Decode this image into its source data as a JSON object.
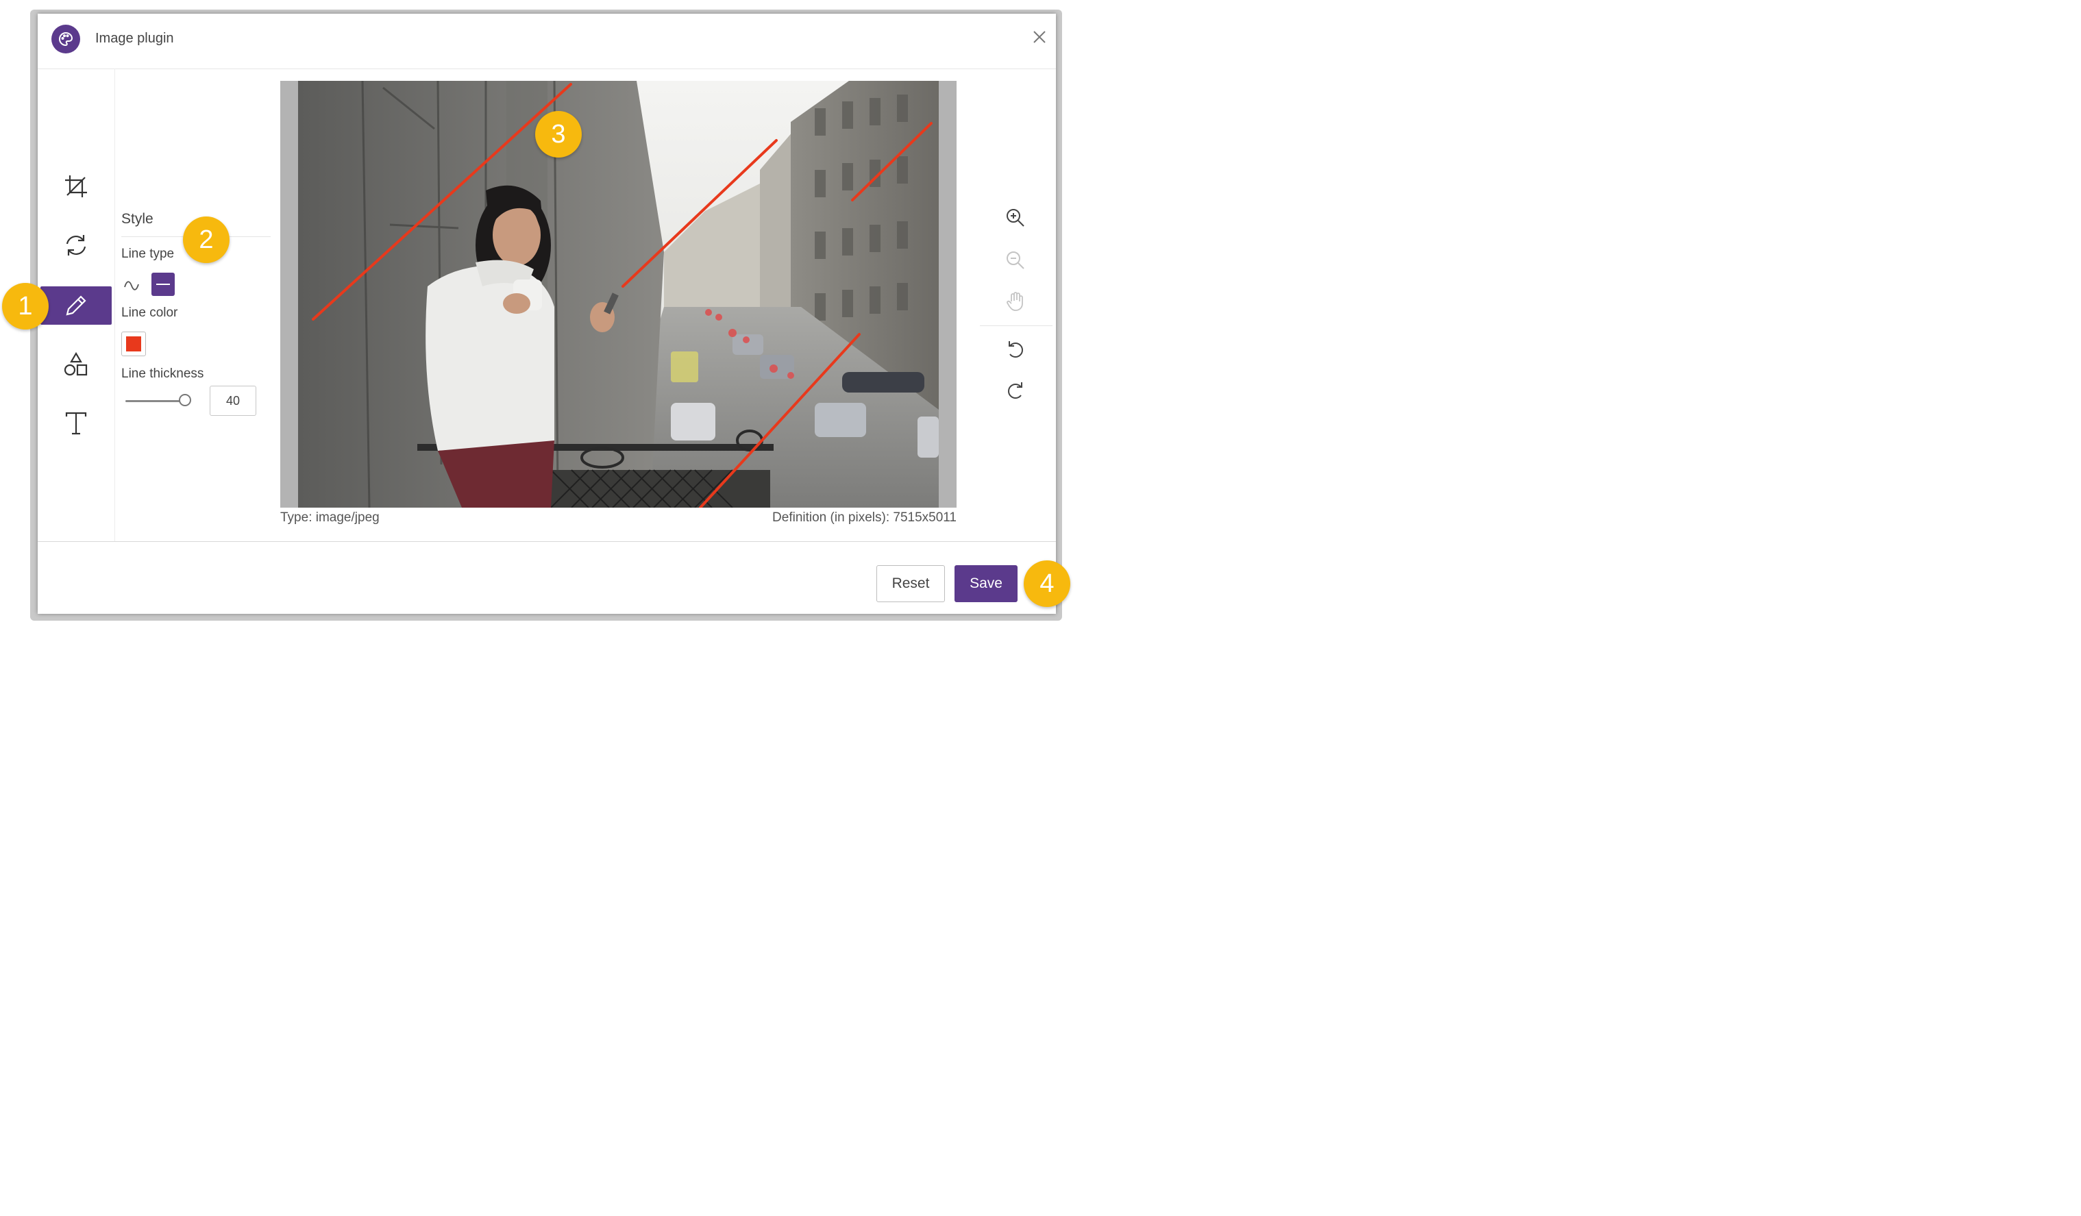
{
  "window": {
    "title": "Image plugin"
  },
  "panel": {
    "style_heading": "Style",
    "line_type_label": "Line type",
    "line_color_label": "Line color",
    "line_thickness_label": "Line thickness",
    "line_thickness_value": "40",
    "line_thickness_fraction": 0.85,
    "line_color": "#e8391c"
  },
  "image_info": {
    "type": "Type: image/jpeg",
    "definition": "Definition (in pixels): 7515x5011"
  },
  "footer": {
    "reset_label": "Reset",
    "save_label": "Save"
  },
  "badges": [
    "1",
    "2",
    "3",
    "4"
  ],
  "colors": {
    "accent": "#5b3a8c",
    "badge": "#f7b90e",
    "drawn_line": "#e8391c"
  }
}
